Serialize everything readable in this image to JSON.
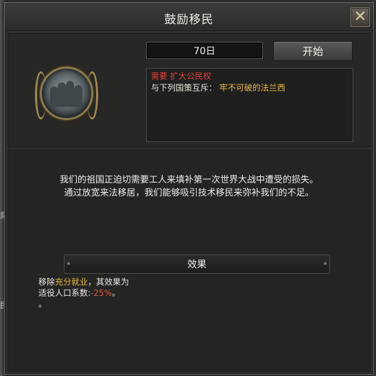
{
  "window": {
    "title": "鼓励移民",
    "close_label": "✕"
  },
  "header": {
    "days": "70日",
    "start_label": "开始"
  },
  "requirements": {
    "needs_label": "需要",
    "needs_value": "扩大公民权",
    "exclusive_label": "与下列国策互斥：",
    "exclusive_value": "牢不可破的法兰西"
  },
  "description": {
    "line1": "我们的祖国正迫切需要工人来填补第一次世界大战中遭受的损失。",
    "line2": "通过放宽来法移居，我们能够吸引技术移民来弥补我们的不足。"
  },
  "effects": {
    "header": "效果",
    "line1_prefix": "移除",
    "line1_highlight": "充分就业",
    "line1_suffix": "，其效果为",
    "line2_prefix": "适役人口系数:",
    "line2_value": "-25%",
    "line2_suffix": "。",
    "line3": "。"
  },
  "background_fragments": [
    "乘",
    "民"
  ],
  "colors": {
    "requirement_red": "#e0403a",
    "highlight_gold": "#e6b84a",
    "negative_value": "#e05a4a"
  }
}
